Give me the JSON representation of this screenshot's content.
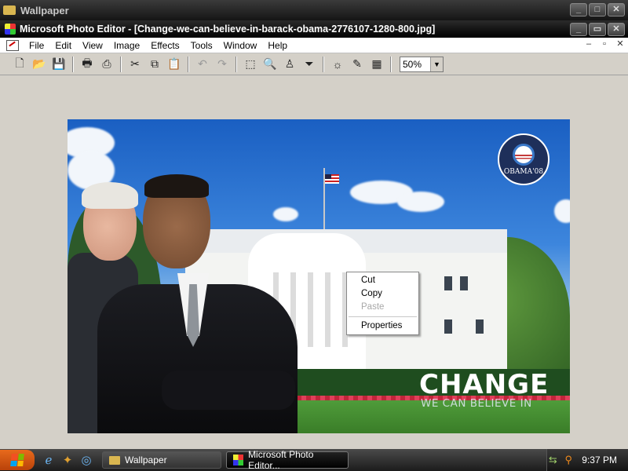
{
  "background_window": {
    "title": "Wallpaper"
  },
  "app": {
    "title": "Microsoft Photo Editor - [Change-we-can-believe-in-barack-obama-2776107-1280-800.jpg]",
    "menu": [
      "File",
      "Edit",
      "View",
      "Image",
      "Effects",
      "Tools",
      "Window",
      "Help"
    ],
    "toolbar": {
      "buttons": [
        "new-icon",
        "open-icon",
        "save-icon",
        "print-icon",
        "scan-icon",
        "cut-icon",
        "copy-icon",
        "paste-icon",
        "undo-icon",
        "redo-icon",
        "select-icon",
        "zoom-icon",
        "smudge-icon",
        "filter-icon",
        "balance-icon",
        "retouch-icon",
        "properties-icon"
      ],
      "zoom_value": "50%"
    }
  },
  "image": {
    "logo_text": "OBAMA'08",
    "headline": "CHANGE",
    "subline": "WE CAN BELIEVE IN"
  },
  "context_menu": {
    "items": [
      {
        "label": "Cut",
        "enabled": true
      },
      {
        "label": "Copy",
        "enabled": true
      },
      {
        "label": "Paste",
        "enabled": false
      },
      {
        "label": "Properties",
        "enabled": true
      }
    ]
  },
  "taskbar": {
    "tasks": [
      {
        "label": "Wallpaper",
        "active": false
      },
      {
        "label": "Microsoft Photo Editor...",
        "active": true
      }
    ],
    "clock": "9:37 PM"
  },
  "colors": {
    "start": "#d8561a",
    "titlebar": "#111111",
    "workspace": "#d4d0c8"
  }
}
